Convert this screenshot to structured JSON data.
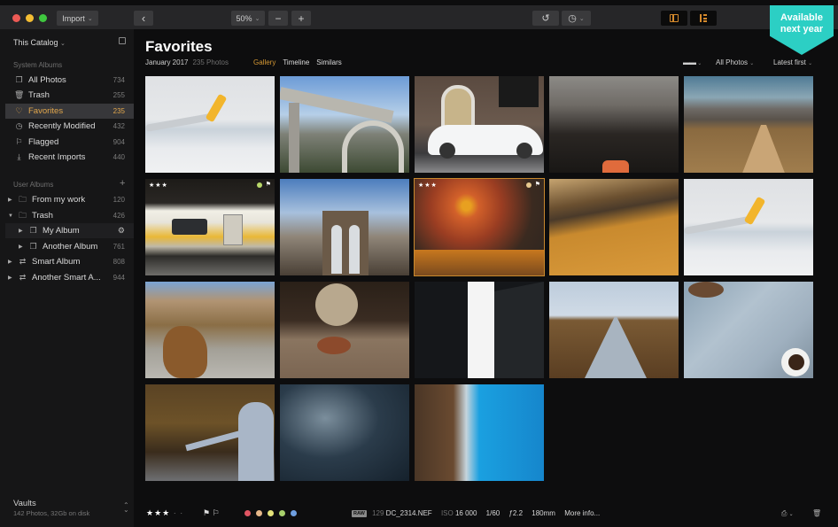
{
  "toolbar": {
    "import_label": "Import",
    "zoom_value": "50%",
    "zoom_out": "−",
    "zoom_in": "+",
    "back": "‹",
    "undo": "↺",
    "history": "◷"
  },
  "badge": {
    "line1": "Available",
    "line2": "next year",
    "color": "#2ccfc4"
  },
  "sidebar": {
    "catalog_label": "This Catalog",
    "system_title": "System Albums",
    "system_items": [
      {
        "label": "All Photos",
        "count": "734",
        "icon": "photos-icon"
      },
      {
        "label": "Trash",
        "count": "255",
        "icon": "trash-icon"
      },
      {
        "label": "Favorites",
        "count": "235",
        "icon": "heart-icon",
        "active": true
      },
      {
        "label": "Recently Modified",
        "count": "432",
        "icon": "clock-icon"
      },
      {
        "label": "Flagged",
        "count": "904",
        "icon": "flag-icon"
      },
      {
        "label": "Recent Imports",
        "count": "440",
        "icon": "import-icon"
      }
    ],
    "user_title": "User Albums",
    "add_label": "+",
    "user_items": [
      {
        "label": "From my work",
        "count": "120",
        "icon": "folder-icon"
      },
      {
        "label": "Trash",
        "count": "426",
        "icon": "folder-icon"
      },
      {
        "label": "My Album",
        "count": "",
        "icon": "album-icon"
      },
      {
        "label": "Another Album",
        "count": "761",
        "icon": "album-icon"
      },
      {
        "label": "Smart Album",
        "count": "808",
        "icon": "smart-album-icon"
      },
      {
        "label": "Another Smart A...",
        "count": "944",
        "icon": "smart-album-icon"
      }
    ],
    "vaults_title": "Vaults",
    "vaults_sub": "142 Photos, 32Gb on disk"
  },
  "main": {
    "title": "Favorites",
    "date": "January 2017",
    "photo_count": "235 Photos",
    "tabs": [
      "Gallery",
      "Timeline",
      "Similars"
    ],
    "filter_all": "All Photos",
    "sort": "Latest first"
  },
  "photos": [
    {
      "subject": "airplane wing over clouds"
    },
    {
      "subject": "concrete arch bridge"
    },
    {
      "subject": "white car by building"
    },
    {
      "subject": "crowded subway platform"
    },
    {
      "subject": "desert road"
    },
    {
      "subject": "yellow train",
      "stars": "★★★",
      "dot_color": "#b8d86a",
      "flag": "⚑"
    },
    {
      "subject": "brooklyn bridge"
    },
    {
      "subject": "venice sunset",
      "stars": "★★★",
      "dot_color": "#e8c98f",
      "flag": "⚑",
      "selected": true
    },
    {
      "subject": "desert dunes footprints"
    },
    {
      "subject": "airplane wing over clouds"
    },
    {
      "subject": "woman out of car window"
    },
    {
      "subject": "globe with magnifier"
    },
    {
      "subject": "black skyscrapers"
    },
    {
      "subject": "suspension footbridge"
    },
    {
      "subject": "map and coffee"
    },
    {
      "subject": "hitchhiker in forest"
    },
    {
      "subject": "dark sea"
    },
    {
      "subject": "aerial coastline"
    }
  ],
  "bottom": {
    "rating_filled": "★★★",
    "rating_empty": "· ·",
    "flag_on": "⚑",
    "flag_off": "⚐",
    "colors": [
      "#e05563",
      "#e7b88a",
      "#e4e27a",
      "#a8d06c",
      "#6f9fe0"
    ],
    "raw": "RAW",
    "index": "129",
    "filename": "DC_2314.NEF",
    "iso_label": "ISO",
    "iso": "16 000",
    "shutter": "1/60",
    "aperture": "ƒ2.2",
    "focal": "180mm",
    "more": "More info..."
  }
}
